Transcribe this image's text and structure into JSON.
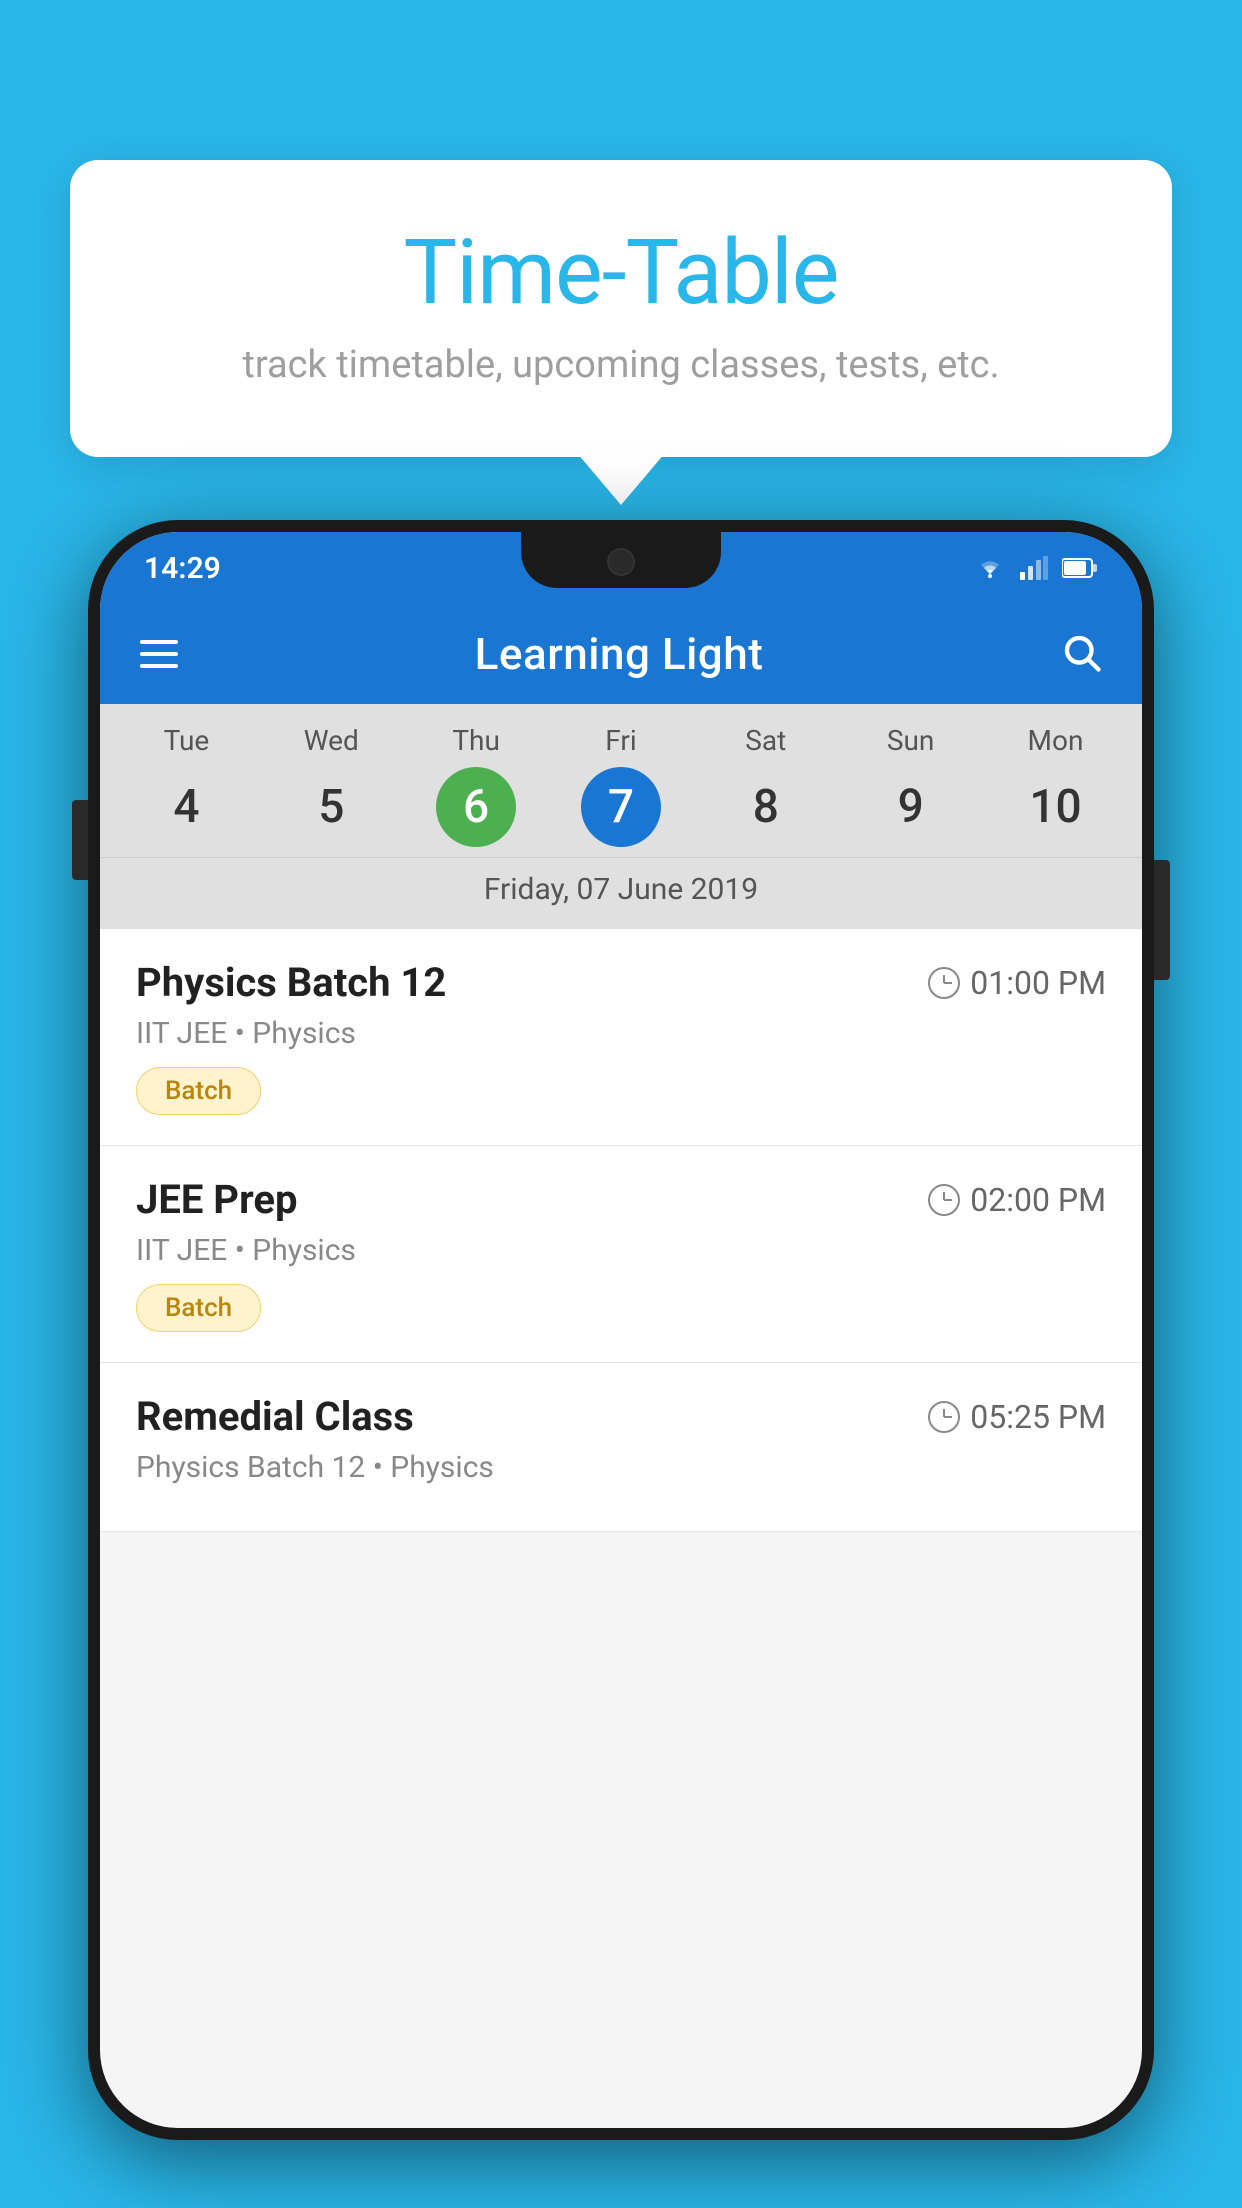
{
  "background_color": "#29b6e8",
  "tooltip": {
    "title": "Time-Table",
    "subtitle": "track timetable, upcoming classes, tests, etc."
  },
  "phone": {
    "status_bar": {
      "time": "14:29"
    },
    "app_bar": {
      "title": "Learning Light"
    },
    "calendar": {
      "days": [
        {
          "label": "Tue",
          "num": "4",
          "state": "normal"
        },
        {
          "label": "Wed",
          "num": "5",
          "state": "normal"
        },
        {
          "label": "Thu",
          "num": "6",
          "state": "today"
        },
        {
          "label": "Fri",
          "num": "7",
          "state": "selected"
        },
        {
          "label": "Sat",
          "num": "8",
          "state": "normal"
        },
        {
          "label": "Sun",
          "num": "9",
          "state": "normal"
        },
        {
          "label": "Mon",
          "num": "10",
          "state": "normal"
        }
      ],
      "selected_date_label": "Friday, 07 June 2019"
    },
    "schedule_items": [
      {
        "title": "Physics Batch 12",
        "time": "01:00 PM",
        "subtitle": "IIT JEE • Physics",
        "tag": "Batch"
      },
      {
        "title": "JEE Prep",
        "time": "02:00 PM",
        "subtitle": "IIT JEE • Physics",
        "tag": "Batch"
      },
      {
        "title": "Remedial Class",
        "time": "05:25 PM",
        "subtitle": "Physics Batch 12 • Physics",
        "tag": null
      }
    ]
  }
}
